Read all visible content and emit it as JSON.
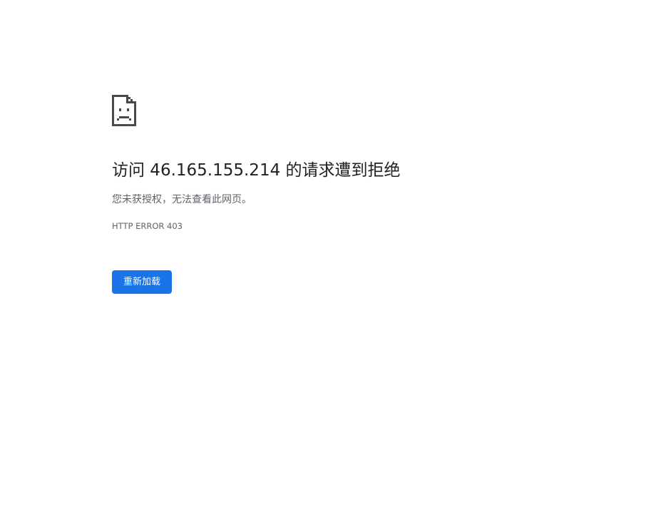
{
  "error_page": {
    "icon": "sad-document-icon",
    "title": "访问 46.165.155.214 的请求遭到拒绝",
    "message": "您未获授权，无法查看此网页。",
    "error_code": "HTTP ERROR 403",
    "reload_label": "重新加载"
  },
  "colors": {
    "background": "#ffffff",
    "title": "#202124",
    "secondary_text": "#5f6368",
    "button": "#1a73e8",
    "button_text": "#ffffff",
    "icon": "#5f6368"
  }
}
